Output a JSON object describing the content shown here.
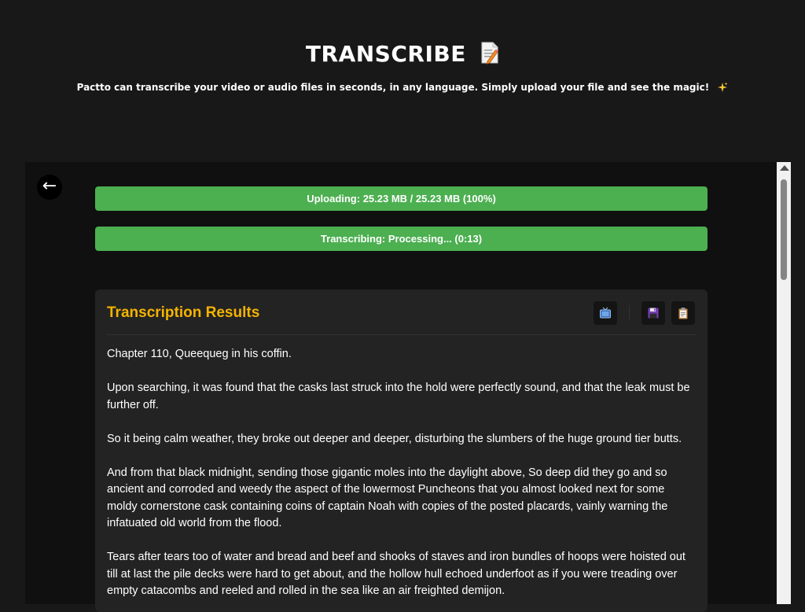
{
  "header": {
    "title": "TRANSCRIBE",
    "title_icon": "memo-icon",
    "subtitle": "Pactto can transcribe your video or audio files in seconds, in any language. Simply upload your file and see the magic!",
    "subtitle_icon": "sparkles-icon"
  },
  "back_button": {
    "label": "←",
    "icon": "back-arrow-icon"
  },
  "upload_progress": {
    "text": "Uploading: 25.23 MB / 25.23 MB (100%)",
    "percent": 100,
    "color": "#4caf50"
  },
  "transcribe_progress": {
    "text": "Transcribing: Processing... (0:13)",
    "percent": 100,
    "color": "#4caf50"
  },
  "results": {
    "title": "Transcription Results",
    "title_color": "#f4b400",
    "actions": [
      {
        "icon": "tv-icon"
      },
      {
        "icon": "floppy-disk-icon"
      },
      {
        "icon": "clipboard-icon"
      }
    ],
    "paragraphs": [
      "Chapter 110, Queequeg in his coffin.",
      "Upon searching, it was found that the casks last struck into the hold were perfectly sound, and that the leak must be further off.",
      "So it being calm weather, they broke out deeper and deeper, disturbing the slumbers of the huge ground tier butts.",
      "And from that black midnight, sending those gigantic moles into the daylight above, So deep did they go and so ancient and corroded and weedy the aspect of the lowermost Puncheons that you almost looked next for some moldy cornerstone cask containing coins of captain Noah with copies of the posted placards, vainly warning the infatuated old world from the flood.",
      "Tears after tears too of water and bread and beef and shooks of staves and iron bundles of hoops were hoisted out till at last the pile decks were hard to get about, and the hollow hull echoed underfoot as if you were treading over empty catacombs and reeled and rolled in the sea like an air freighted demijon."
    ]
  },
  "colors": {
    "background": "#181818",
    "panel": "#101010",
    "card": "#232323",
    "progress": "#4caf50",
    "accent": "#f4b400"
  }
}
